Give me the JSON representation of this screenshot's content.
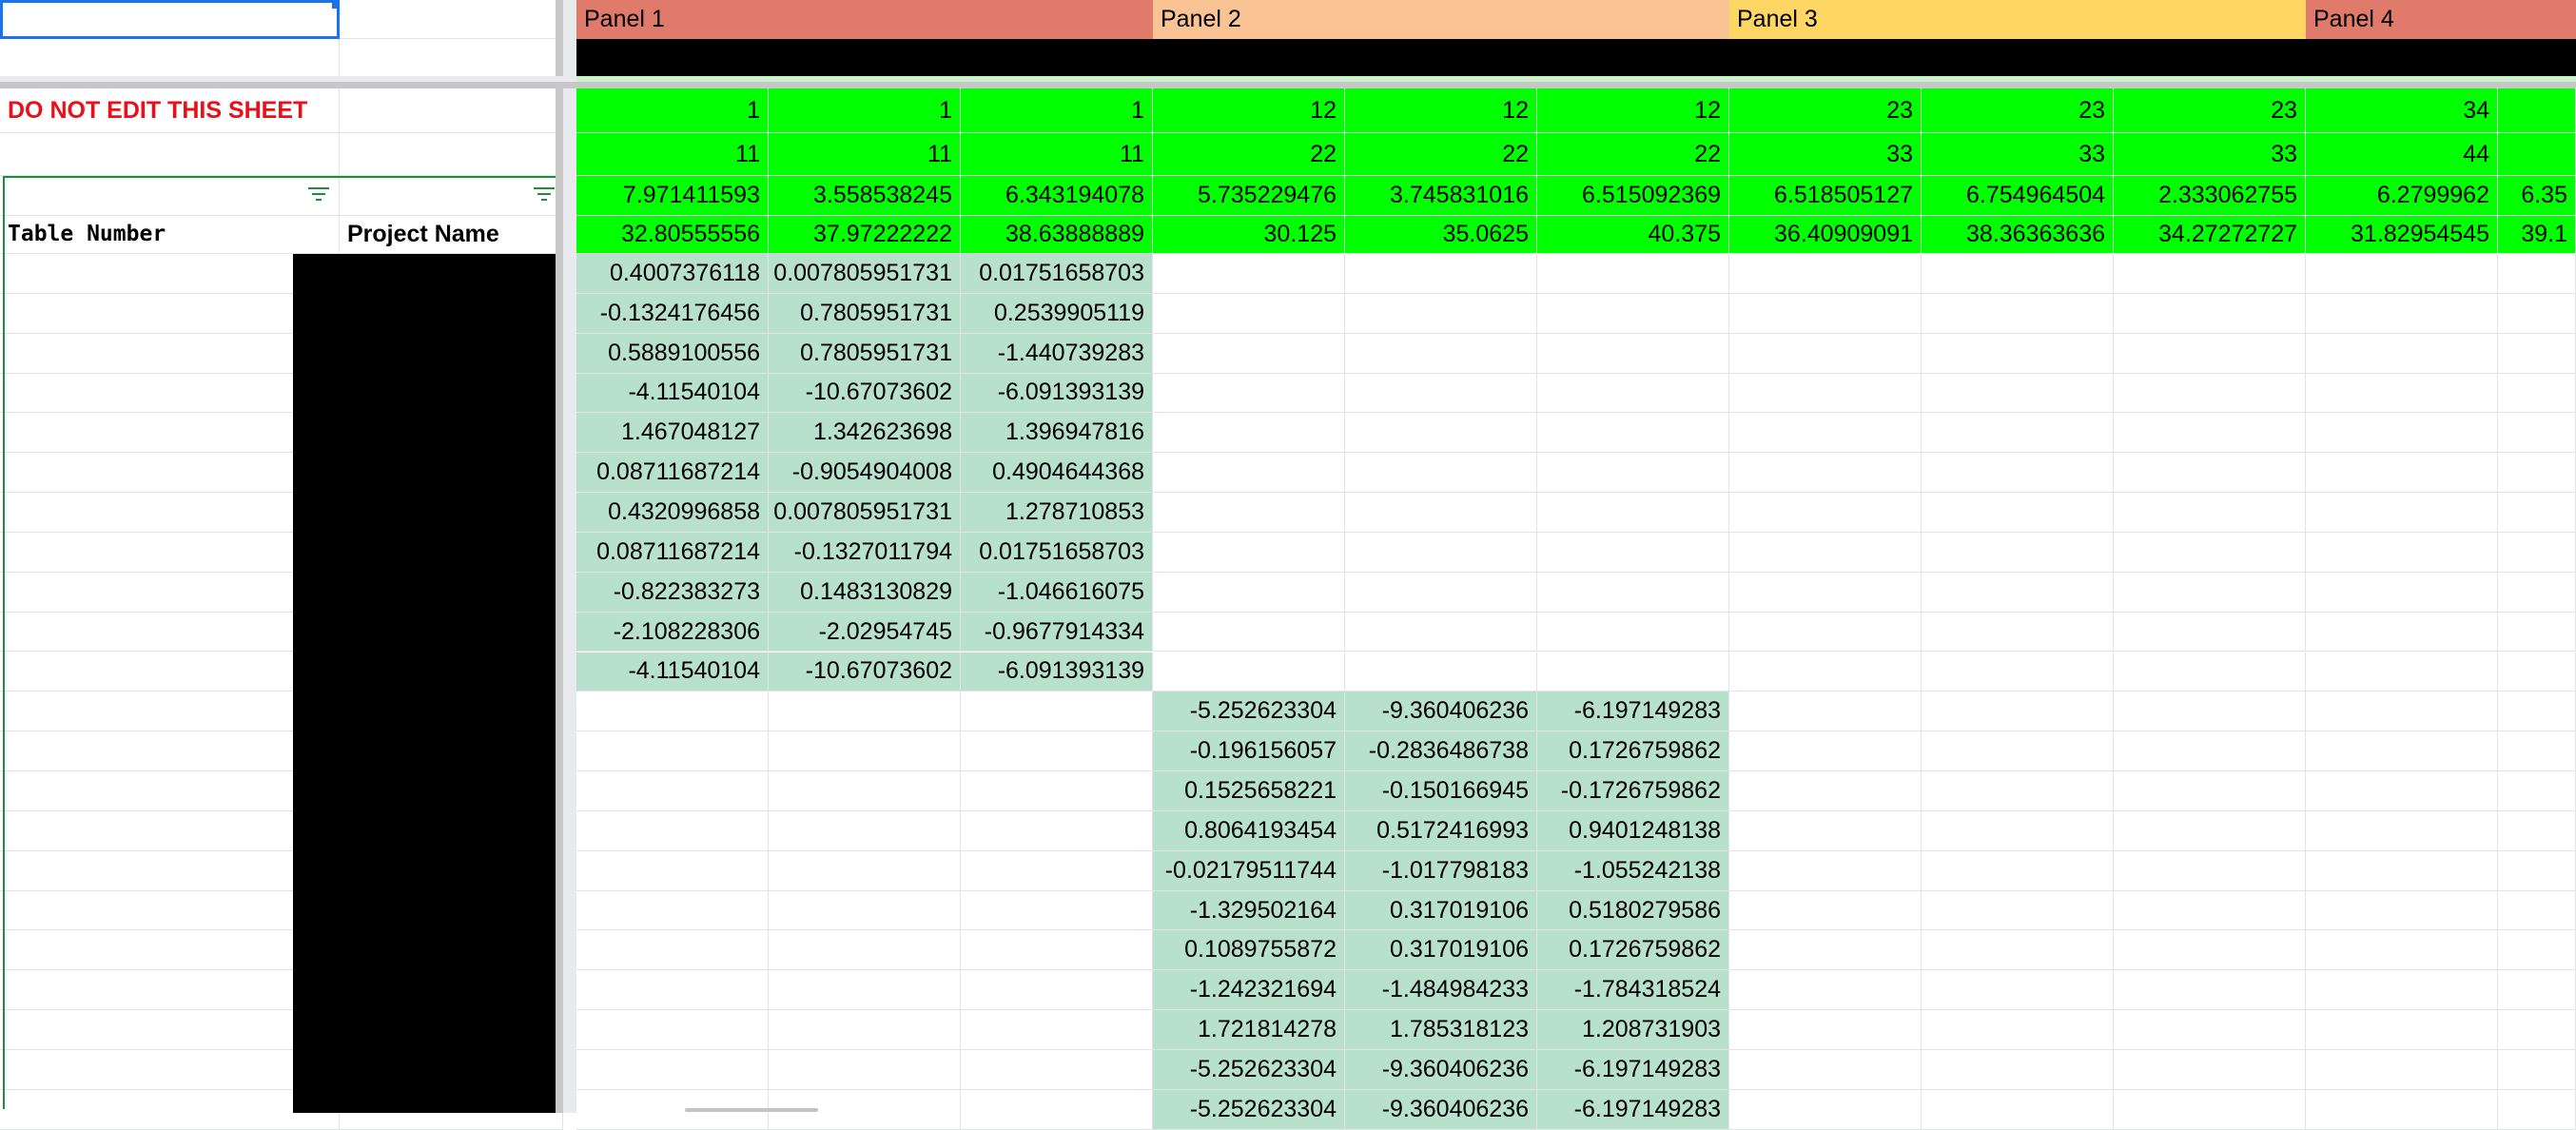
{
  "sheet": {
    "warning": "DO NOT EDIT THIS SHEET",
    "columns": {
      "table_number": "Table Number",
      "project_name": "Project Name"
    },
    "panels": [
      {
        "label": "Panel 1",
        "color": "#e07b6c"
      },
      {
        "label": "Panel 2",
        "color": "#f9c394"
      },
      {
        "label": "Panel 3",
        "color": "#fdd663"
      },
      {
        "label": "Panel 4",
        "color": "#e07b6c"
      }
    ],
    "colors": {
      "header_green": "#00ff00",
      "data_green": "#b7e1cd",
      "warning_red": "#e8101a",
      "selection_blue": "#1a73e8",
      "filter_green": "#1e8e3e",
      "redacted": "#000000"
    },
    "header_rows": [
      [
        "1",
        "1",
        "1",
        "12",
        "12",
        "12",
        "23",
        "23",
        "23",
        "34",
        ""
      ],
      [
        "11",
        "11",
        "11",
        "22",
        "22",
        "22",
        "33",
        "33",
        "33",
        "44",
        ""
      ],
      [
        "7.971411593",
        "3.558538245",
        "6.343194078",
        "5.735229476",
        "3.745831016",
        "6.515092369",
        "6.518505127",
        "6.754964504",
        "2.333062755",
        "6.2799962",
        "6.35"
      ],
      [
        "32.80555556",
        "37.97222222",
        "38.63888889",
        "30.125",
        "35.0625",
        "40.375",
        "36.40909091",
        "38.36363636",
        "34.27272727",
        "31.82954545",
        "39.1"
      ]
    ],
    "panel1_rows": [
      [
        "0.4007376118",
        "0.007805951731",
        "0.01751658703"
      ],
      [
        "-0.1324176456",
        "0.7805951731",
        "0.2539905119"
      ],
      [
        "0.5889100556",
        "0.7805951731",
        "-1.440739283"
      ],
      [
        "-4.11540104",
        "-10.67073602",
        "-6.091393139"
      ],
      [
        "1.467048127",
        "1.342623698",
        "1.396947816"
      ],
      [
        "0.08711687214",
        "-0.9054904008",
        "0.4904644368"
      ],
      [
        "0.4320996858",
        "0.007805951731",
        "1.278710853"
      ],
      [
        "0.08711687214",
        "-0.1327011794",
        "0.01751658703"
      ],
      [
        "-0.822383273",
        "0.1483130829",
        "-1.046616075"
      ],
      [
        "-2.108228306",
        "-2.02954745",
        "-0.9677914334"
      ],
      [
        "-4.11540104",
        "-10.67073602",
        "-6.091393139"
      ]
    ],
    "panel2_rows": [
      [
        "-5.252623304",
        "-9.360406236",
        "-6.197149283"
      ],
      [
        "-0.196156057",
        "-0.2836486738",
        "0.1726759862"
      ],
      [
        "0.1525658221",
        "-0.150166945",
        "-0.1726759862"
      ],
      [
        "0.8064193454",
        "0.5172416993",
        "0.9401248138"
      ],
      [
        "-0.02179511744",
        "-1.017798183",
        "-1.055242138"
      ],
      [
        "-1.329502164",
        "0.317019106",
        "0.5180279586"
      ],
      [
        "0.1089755872",
        "0.317019106",
        "0.1726759862"
      ],
      [
        "-1.242321694",
        "-1.484984233",
        "-1.784318524"
      ],
      [
        "1.721814278",
        "1.785318123",
        "1.208731903"
      ],
      [
        "-5.252623304",
        "-9.360406236",
        "-6.197149283"
      ],
      [
        "-5.252623304",
        "-9.360406236",
        "-6.197149283"
      ]
    ]
  }
}
